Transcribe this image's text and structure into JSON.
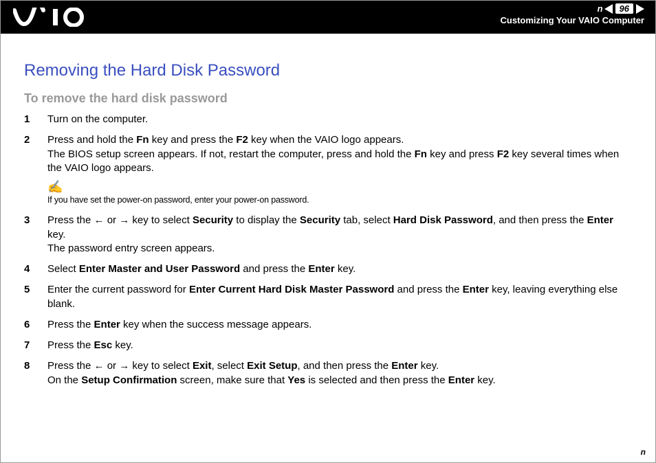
{
  "header": {
    "page_number": "96",
    "section": "Customizing Your VAIO Computer"
  },
  "title": "Removing the Hard Disk Password",
  "subtitle": "To remove the hard disk password",
  "steps": {
    "s1": "Turn on the computer.",
    "s2_a": "Press and hold the ",
    "s2_fn": "Fn",
    "s2_b": " key and press the ",
    "s2_f2": "F2",
    "s2_c": " key when the VAIO logo appears.",
    "s2_line2a": "The BIOS setup screen appears. If not, restart the computer, press and hold the ",
    "s2_line2b": " key and press ",
    "s2_line2c": " key several times when the VAIO logo appears.",
    "note_icon": "✍",
    "note_text": "If you have set the power-on password, enter your power-on password.",
    "s3_a": "Press the ",
    "s3_b": " or ",
    "s3_c": " key to select ",
    "s3_security": "Security",
    "s3_d": " to display the ",
    "s3_e": " tab, select ",
    "s3_hdp": "Hard Disk Password",
    "s3_f": ", and then press the ",
    "s3_enter": "Enter",
    "s3_g": " key.",
    "s3_line2": "The password entry screen appears.",
    "s4_a": "Select ",
    "s4_emup": "Enter Master and User Password",
    "s4_b": " and press the ",
    "s4_c": " key.",
    "s5_a": "Enter the current password for ",
    "s5_echdmp": "Enter Current Hard Disk Master Password",
    "s5_b": " and press the ",
    "s5_c": " key, leaving everything else blank.",
    "s6_a": "Press the ",
    "s6_b": " key when the success message appears.",
    "s7_a": "Press the ",
    "s7_esc": "Esc",
    "s7_b": " key.",
    "s8_a": "Press the ",
    "s8_b": " or ",
    "s8_c": " key to select ",
    "s8_exit": "Exit",
    "s8_d": ", select ",
    "s8_exitsetup": "Exit Setup",
    "s8_e": ", and then press the ",
    "s8_f": " key.",
    "s8_line2a": "On the ",
    "s8_sc": "Setup Confirmation",
    "s8_line2b": " screen, make sure that ",
    "s8_yes": "Yes",
    "s8_line2c": " is selected and then press the ",
    "s8_line2d": " key."
  },
  "footer": {
    "n": "n"
  },
  "arrows": {
    "left": "←",
    "right": "→"
  }
}
